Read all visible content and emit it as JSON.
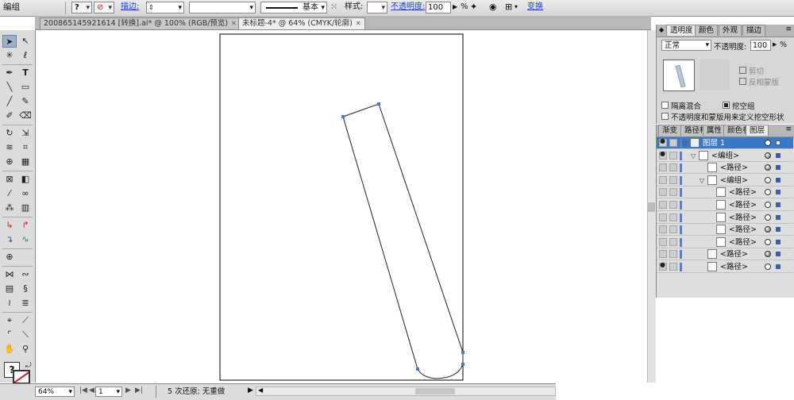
{
  "control_bar": {
    "selection_label": "编组",
    "stroke_label": "描边:",
    "brush_label": "基本",
    "style_label": "样式:",
    "opacity_label": "不透明度:",
    "opacity_value": "100",
    "opacity_unit": "%",
    "transform_label": "变换"
  },
  "tabs": [
    {
      "label": "200865145921614 [转换].ai* @ 100% (RGB/预览)"
    },
    {
      "label": "未标题-4* @ 64% (CMYK/轮廓)"
    }
  ],
  "transparency_panel": {
    "tabs": [
      "透明度",
      "颜色",
      "外观",
      "描边"
    ],
    "blend_mode": "正常",
    "opacity_label": "不透明度:",
    "opacity_value": "100",
    "opacity_unit": "%",
    "clip_label": "剪切",
    "invert_mask_label": "反相蒙版",
    "isolate_blending_label": "隔离混合",
    "knockout_group_label": "挖空组",
    "opacity_mask_knockout_label": "不透明度和蒙版用来定义挖空形状"
  },
  "layers_panel": {
    "tabs": [
      "渐变",
      "路径相",
      "属性",
      "颜色参",
      "图层"
    ],
    "rows": [
      {
        "name": "图层 1",
        "indent": 0,
        "expanded": true
      },
      {
        "name": "<编组>",
        "indent": 1,
        "expanded": true
      },
      {
        "name": "<路径>",
        "indent": 2
      },
      {
        "name": "<编组>",
        "indent": 2,
        "expanded": true
      },
      {
        "name": "<路径>",
        "indent": 3
      },
      {
        "name": "<路径>",
        "indent": 3
      },
      {
        "name": "<路径>",
        "indent": 3
      },
      {
        "name": "<路径>",
        "indent": 3
      },
      {
        "name": "<路径>",
        "indent": 3
      },
      {
        "name": "<路径>",
        "indent": 2
      },
      {
        "name": "<路径>",
        "indent": 2
      }
    ]
  },
  "status_bar": {
    "zoom": "64%",
    "artboard": "1",
    "undo_status": "5 次还原; 无重做"
  },
  "colors": {
    "accent": "#3a78c8",
    "anchor": "#4a78d8"
  }
}
